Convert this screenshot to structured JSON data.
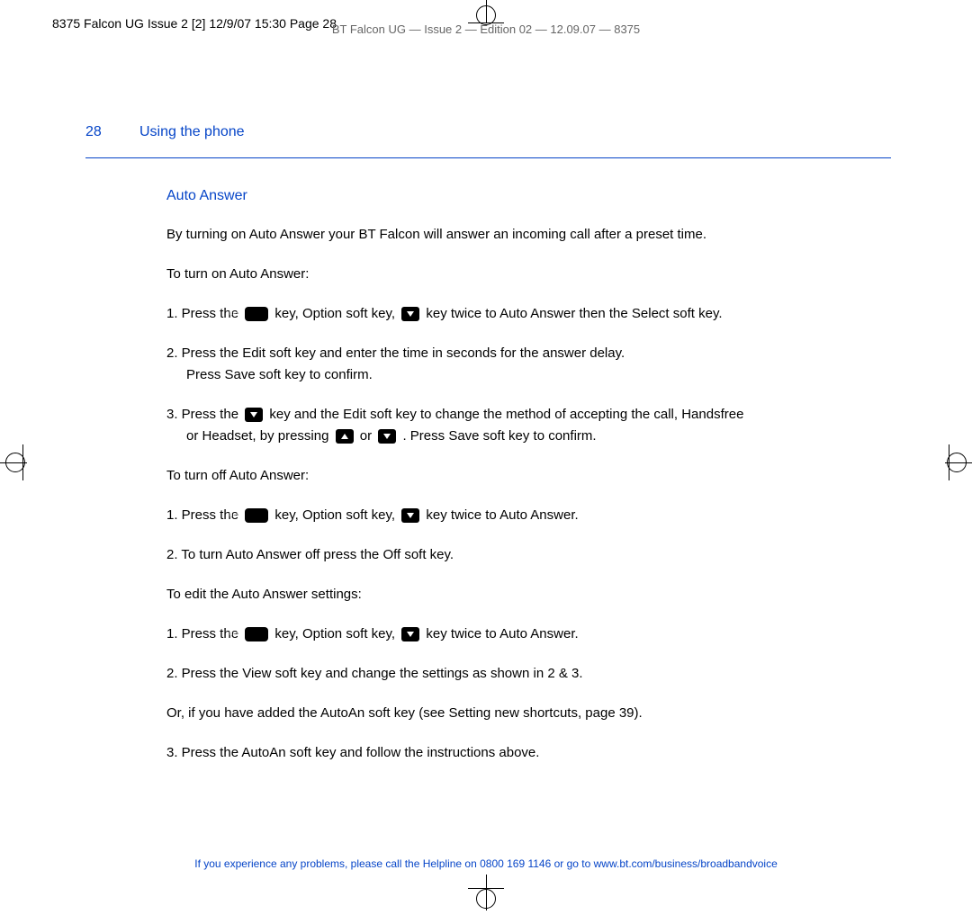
{
  "print": {
    "topline": "8375 Falcon UG Issue 2 [2]  12/9/07  15:30  Page 28",
    "topmeta": "BT Falcon UG — Issue 2 — Edition 02 — 12.09.07 — 8375"
  },
  "header": {
    "page_number": "28",
    "section_title": "Using the phone",
    "subheading": "Auto Answer"
  },
  "body": {
    "intro": "By turning on Auto Answer your BT Falcon will answer an incoming call after a preset time.",
    "turn_on_label": "To turn on Auto Answer:",
    "on_1a": "1.  Press the ",
    "on_1b": " key, ",
    "on_1c": "Option",
    "on_1d": " soft key, ",
    "on_1e": " key twice to ",
    "on_1f": "Auto Answer",
    "on_1g": " then the ",
    "on_1h": "Select",
    "on_1i": " soft key.",
    "on_2a": "2.  Press the Edit soft key and enter the time in seconds for the answer delay.",
    "on_2b": "Press ",
    "on_2c": "Save",
    "on_2d": " soft key to confirm.",
    "on_3a": "3.  Press the ",
    "on_3b": " key and the ",
    "on_3c": "Edit",
    "on_3d": " soft key to change the method of accepting the call, ",
    "on_3e": "Handsfree",
    "on_3f": "or ",
    "on_3g": "Headset",
    "on_3h": ", by pressing ",
    "on_3i": " or ",
    "on_3j": " . Press ",
    "on_3k": "Save",
    "on_3l": " soft key to confirm.",
    "turn_off_label": "To turn off Auto Answer:",
    "off_1a": "1.  Press the ",
    "off_1b": " key, ",
    "off_1c": "Option",
    "off_1d": " soft key, ",
    "off_1e": " key twice to ",
    "off_1f": "Auto Answer",
    "off_1g": ".",
    "off_2a": "2.  To turn Auto Answer off press the ",
    "off_2b": "Off",
    "off_2c": " soft key.",
    "edit_label": "To edit the Auto Answer settings:",
    "edit_1a": "1.  Press the ",
    "edit_1b": " key, ",
    "edit_1c": "Option",
    "edit_1d": " soft key, ",
    "edit_1e": " key twice to ",
    "edit_1f": "Auto Answer",
    "edit_1g": ".",
    "edit_2a": "2.  Press the ",
    "edit_2b": "View",
    "edit_2c": " soft key and change the settings as shown in 2 & 3.",
    "edit_or_a": "Or, if you have added the ",
    "edit_or_b": "AutoAn",
    "edit_or_c": " soft key (see Setting new shortcuts, page 39).",
    "edit_3a": "3.  Press the ",
    "edit_3b": "AutoAn",
    "edit_3c": " soft key and follow the instructions above."
  },
  "footer": {
    "text": "If you experience any problems, please call the Helpline on 0800 169 1146 or go to www.bt.com/business/broadbandvoice"
  }
}
